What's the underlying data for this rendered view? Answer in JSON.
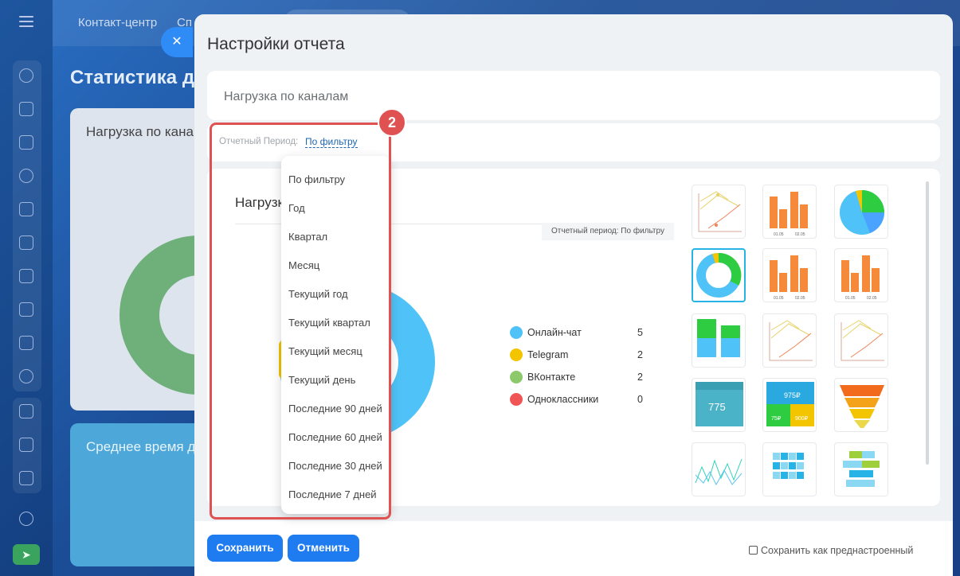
{
  "background": {
    "topbar": {
      "item1": "Контакт-центр",
      "item2": "Сп"
    },
    "page_title": "Статистика ди",
    "card1_title": "Нагрузка по кана",
    "card2_title": "Среднее время д"
  },
  "panel": {
    "title": "Настройки отчета",
    "report_name": "Нагрузка по каналам",
    "period_label": "Отчетный Период:",
    "period_value": "По фильтру"
  },
  "preview": {
    "title": "Нагрузка по каналам",
    "period_badge": "Отчетный период: По фильтру",
    "legend": [
      {
        "name": "Онлайн-чат",
        "value": "5",
        "color": "#4fc3f7"
      },
      {
        "name": "Telegram",
        "value": "2",
        "color": "#f2c500"
      },
      {
        "name": "ВКонтакте",
        "value": "2",
        "color": "#8cc96a"
      },
      {
        "name": "Одноклассники",
        "value": "0",
        "color": "#f05454"
      }
    ],
    "thumbs": [
      "line-chart-icon",
      "bar-chart-icon",
      "pie-chart-icon",
      "donut-chart-icon",
      "bar-chart-icon",
      "bar-chart-icon",
      "stacked-bar-icon",
      "line-chart-icon",
      "line-chart-icon",
      "number-widget-icon",
      "multi-number-widget-icon",
      "funnel-icon",
      "zigzag-line-icon",
      "heatmap-icon",
      "horizontal-bar-icon"
    ],
    "thumb_labels": {
      "bar_x1": "01.05",
      "bar_x2": "02.05",
      "number": "775",
      "multi_top": "975₽",
      "multi_bl": "75₽",
      "multi_br": "900₽"
    }
  },
  "dropdown": {
    "items": [
      "По фильтру",
      "Год",
      "Квартал",
      "Месяц",
      "Текущий год",
      "Текущий квартал",
      "Текущий месяц",
      "Текущий день",
      "Последние 90 дней",
      "Последние 60 дней",
      "Последние 30 дней",
      "Последние 7 дней"
    ]
  },
  "annotation": {
    "badge": "2",
    "color": "#e05252"
  },
  "footer": {
    "save": "Сохранить",
    "cancel": "Отменить",
    "preset_label": "Сохранить как преднастроенный"
  },
  "colors": {
    "accent": "#1f7cf0",
    "highlight": "#e05252"
  }
}
